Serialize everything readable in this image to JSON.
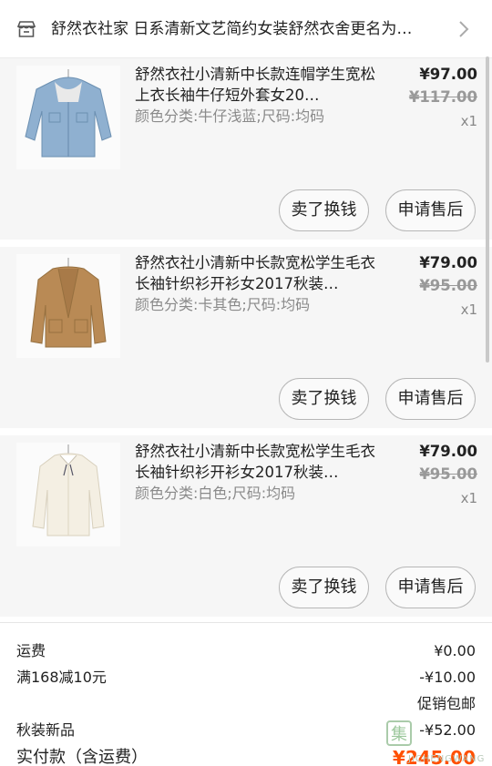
{
  "shop": {
    "name": "舒然衣社家 日系清新文艺简约女装舒然衣舍更名为…",
    "icon": "store-icon"
  },
  "items": [
    {
      "title": "舒然衣社小清新中长款连帽学生宽松上衣长袖牛仔短外套女20…",
      "sku": "颜色分类:牛仔浅蓝;尺码:均码",
      "price": "¥97.00",
      "original_price": "¥117.00",
      "qty": "x1",
      "image": "denim-jacket",
      "color": "#8fb0d0",
      "sell_label": "卖了换钱",
      "after_sale_label": "申请售后"
    },
    {
      "title": "舒然衣社小清新中长款宽松学生毛衣长袖针织衫开衫女2017秋装…",
      "sku": "颜色分类:卡其色;尺码:均码",
      "price": "¥79.00",
      "original_price": "¥95.00",
      "qty": "x1",
      "image": "khaki-cardigan",
      "color": "#b98a55",
      "sell_label": "卖了换钱",
      "after_sale_label": "申请售后"
    },
    {
      "title": "舒然衣社小清新中长款宽松学生毛衣长袖针织衫开衫女2017秋装…",
      "sku": "颜色分类:白色;尺码:均码",
      "price": "¥79.00",
      "original_price": "¥95.00",
      "qty": "x1",
      "image": "white-cardigan",
      "color": "#f4efe3",
      "sell_label": "卖了换钱",
      "after_sale_label": "申请售后"
    }
  ],
  "summary": {
    "shipping_label": "运费",
    "shipping_value": "¥0.00",
    "discount_label": "满168减10元",
    "discount_value": "-¥10.00",
    "promo_tag": "促销包邮",
    "autumn_label": "秋装新品",
    "autumn_value": "-¥52.00",
    "total_label": "实付款（含运费）",
    "total_value": "¥245.00"
  },
  "watermark": {
    "text": "JICHENGWANG",
    "glyph": "集"
  },
  "colors": {
    "accent": "#ff5000",
    "item_bg": "#f6f6f6",
    "muted": "#8a8a8a"
  }
}
